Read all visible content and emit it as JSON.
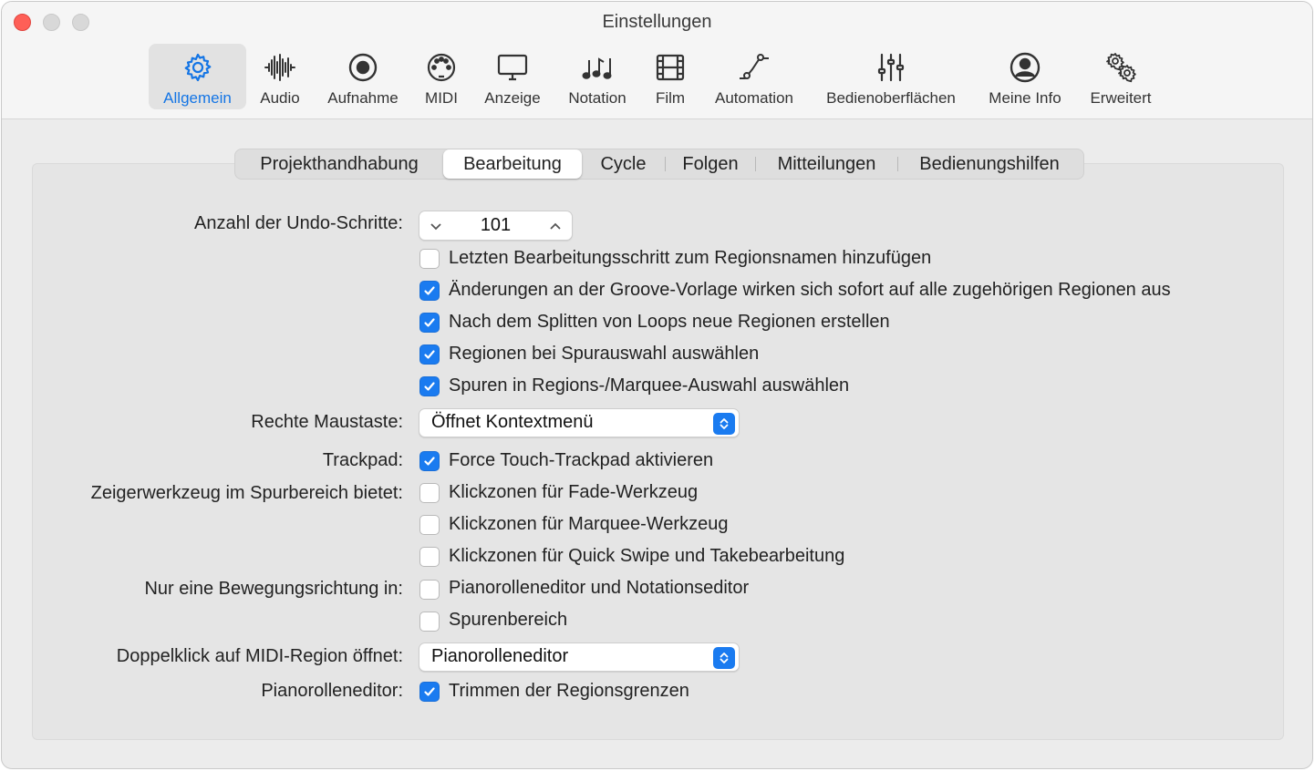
{
  "window": {
    "title": "Einstellungen"
  },
  "toolbar": {
    "items": [
      {
        "label": "Allgemein",
        "icon": "gear-icon",
        "active": true
      },
      {
        "label": "Audio",
        "icon": "waveform-icon"
      },
      {
        "label": "Aufnahme",
        "icon": "record-icon"
      },
      {
        "label": "MIDI",
        "icon": "midi-icon"
      },
      {
        "label": "Anzeige",
        "icon": "display-icon"
      },
      {
        "label": "Notation",
        "icon": "notes-icon"
      },
      {
        "label": "Film",
        "icon": "film-icon"
      },
      {
        "label": "Automation",
        "icon": "automation-icon"
      },
      {
        "label": "Bedienoberflächen",
        "icon": "sliders-icon"
      },
      {
        "label": "Meine Info",
        "icon": "person-icon"
      },
      {
        "label": "Erweitert",
        "icon": "gears-icon"
      }
    ]
  },
  "tabs": [
    {
      "label": "Projekthandhabung"
    },
    {
      "label": "Bearbeitung",
      "active": true
    },
    {
      "label": "Cycle"
    },
    {
      "label": "Folgen"
    },
    {
      "label": "Mitteilungen"
    },
    {
      "label": "Bedienungshilfen"
    }
  ],
  "settings": {
    "undo_label": "Anzahl der Undo-Schritte:",
    "undo_value": "101",
    "checkboxes": [
      {
        "label": "Letzten Bearbeitungsschritt zum Regionsnamen hinzufügen",
        "checked": false
      },
      {
        "label": "Änderungen an der Groove-Vorlage wirken sich sofort auf alle zugehörigen Regionen aus",
        "checked": true
      },
      {
        "label": "Nach dem Splitten von Loops neue Regionen erstellen",
        "checked": true
      },
      {
        "label": "Regionen bei Spurauswahl auswählen",
        "checked": true
      },
      {
        "label": "Spuren in Regions-/Marquee-Auswahl auswählen",
        "checked": true
      }
    ],
    "right_mouse_label": "Rechte Maustaste:",
    "right_mouse_value": "Öffnet Kontextmenü",
    "trackpad_label": "Trackpad:",
    "trackpad_checkbox": {
      "label": "Force Touch-Trackpad aktivieren",
      "checked": true
    },
    "pointer_label": "Zeigerwerkzeug im Spurbereich bietet:",
    "pointer_checkboxes": [
      {
        "label": "Klickzonen für Fade-Werkzeug",
        "checked": false
      },
      {
        "label": "Klickzonen für Marquee-Werkzeug",
        "checked": false
      },
      {
        "label": "Klickzonen für Quick Swipe und Takebearbeitung",
        "checked": false
      }
    ],
    "direction_label": "Nur eine Bewegungsrichtung in:",
    "direction_checkboxes": [
      {
        "label": "Pianorolleneditor und Notationseditor",
        "checked": false
      },
      {
        "label": "Spurenbereich",
        "checked": false
      }
    ],
    "doubleclick_label": "Doppelklick auf MIDI-Region öffnet:",
    "doubleclick_value": "Pianorolleneditor",
    "pianoroll_label": "Pianorolleneditor:",
    "pianoroll_checkbox": {
      "label": "Trimmen der Regionsgrenzen",
      "checked": true
    }
  },
  "colors": {
    "accent": "#1a7bf0",
    "close": "#fe5f57"
  }
}
